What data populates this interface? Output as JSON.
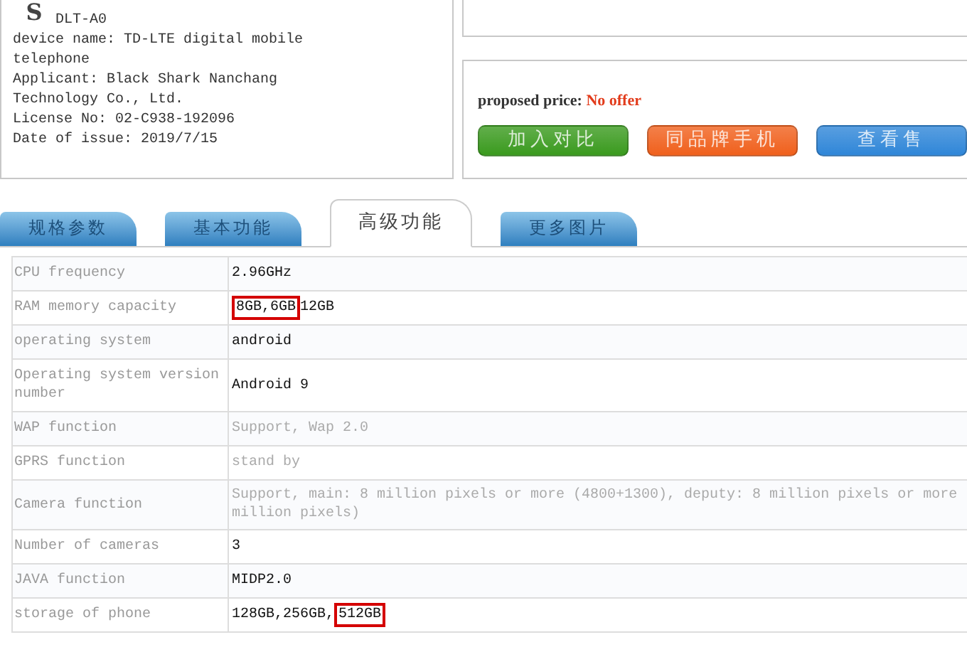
{
  "product": {
    "logo": "S",
    "model": "DLT-A0",
    "lines": [
      "device name: TD-LTE digital mobile telephone",
      "Applicant: Black Shark Nanchang Technology Co., Ltd.",
      "License No: 02-C938-192096",
      "Date of issue: 2019/7/15"
    ]
  },
  "price": {
    "label": "proposed price:",
    "value": "No offer"
  },
  "buttons": [
    {
      "label": "加入对比",
      "color": "#3a9a1e"
    },
    {
      "label": "同品牌手机",
      "color": "#f0601c"
    },
    {
      "label": "查看售",
      "color": "#2f86d8"
    }
  ],
  "tabs": [
    {
      "label": "规格参数",
      "selected": false
    },
    {
      "label": "基本功能",
      "selected": false
    },
    {
      "label": "高级功能",
      "selected": true
    },
    {
      "label": "更多图片",
      "selected": false
    }
  ],
  "specs": [
    {
      "label": "CPU frequency",
      "muted": false,
      "value": [
        {
          "text": "2.96GHz",
          "highlighted": false
        }
      ]
    },
    {
      "label": "RAM memory capacity",
      "muted": false,
      "value": [
        {
          "text": "8GB,6GB",
          "highlighted": true
        },
        {
          "text": "12GB",
          "highlighted": false
        }
      ]
    },
    {
      "label": "operating system",
      "muted": false,
      "value": [
        {
          "text": "android",
          "highlighted": false
        }
      ]
    },
    {
      "label": "Operating system version number",
      "muted": false,
      "value": [
        {
          "text": "Android 9",
          "highlighted": false
        }
      ]
    },
    {
      "label": "WAP function",
      "muted": true,
      "value": [
        {
          "text": "Support, Wap 2.0",
          "highlighted": false
        }
      ]
    },
    {
      "label": "GPRS function",
      "muted": true,
      "value": [
        {
          "text": "stand by",
          "highlighted": false
        }
      ]
    },
    {
      "label": "Camera function",
      "muted": true,
      "value": [
        {
          "text": "Support, main: 8 million pixels or more (4800+1300), deputy: 8 million pixels or more million pixels)",
          "highlighted": false
        }
      ]
    },
    {
      "label": "Number of cameras",
      "muted": false,
      "value": [
        {
          "text": "3",
          "highlighted": false
        }
      ]
    },
    {
      "label": "JAVA function",
      "muted": false,
      "value": [
        {
          "text": "MIDP2.0",
          "highlighted": false
        }
      ]
    },
    {
      "label": "storage of phone",
      "muted": false,
      "value": [
        {
          "text": "128GB,256GB,",
          "highlighted": false
        },
        {
          "text": "512GB",
          "highlighted": true
        }
      ]
    }
  ]
}
